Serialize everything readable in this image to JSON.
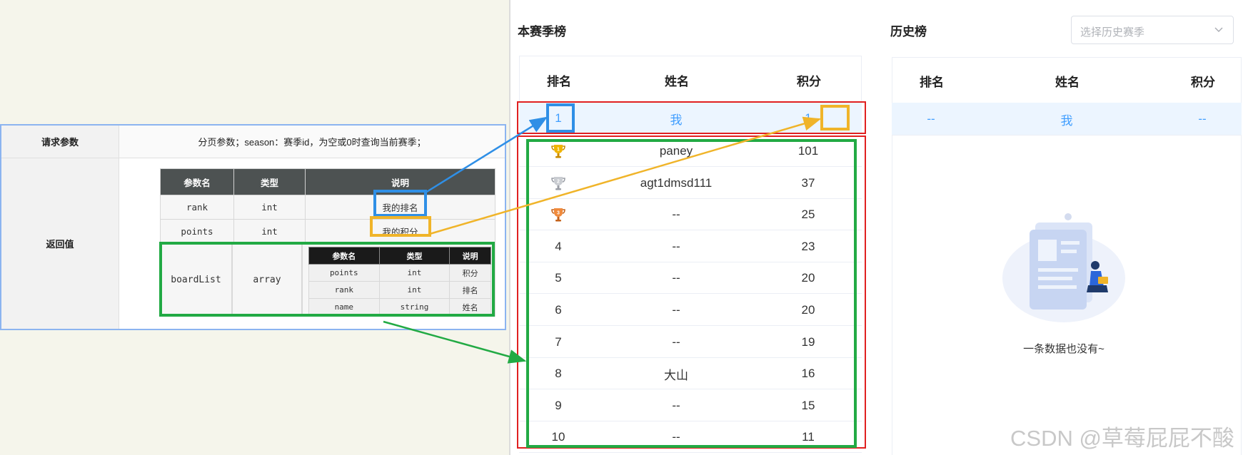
{
  "doc": {
    "request_label": "请求参数",
    "request_value": "分页参数；season：赛季id，为空或0时查询当前赛季；",
    "return_label": "返回值",
    "headers": [
      "参数名",
      "类型",
      "说明"
    ],
    "rows": [
      {
        "name": "rank",
        "type": "int",
        "desc": "我的排名"
      },
      {
        "name": "points",
        "type": "int",
        "desc": "我的积分"
      }
    ],
    "board": {
      "name": "boardList",
      "type": "array"
    },
    "sub_headers": [
      "参数名",
      "类型",
      "说明"
    ],
    "sub_rows": [
      {
        "name": "points",
        "type": "int",
        "desc": "积分"
      },
      {
        "name": "rank",
        "type": "int",
        "desc": "排名"
      },
      {
        "name": "name",
        "type": "string",
        "desc": "姓名"
      }
    ]
  },
  "current": {
    "title": "本赛季榜",
    "headers": [
      "排名",
      "姓名",
      "积分"
    ],
    "me": {
      "rank": "1",
      "name": "我",
      "points": "1"
    },
    "rows": [
      {
        "rank": "1",
        "name": "paney",
        "points": "101",
        "trophy": "gold-trophy-icon"
      },
      {
        "rank": "2",
        "name": "agt1dmsd111",
        "points": "37",
        "trophy": "silver-trophy-icon"
      },
      {
        "rank": "3",
        "name": "--",
        "points": "25",
        "trophy": "bronze-trophy-icon"
      },
      {
        "rank": "4",
        "name": "--",
        "points": "23"
      },
      {
        "rank": "5",
        "name": "--",
        "points": "20"
      },
      {
        "rank": "6",
        "name": "--",
        "points": "20"
      },
      {
        "rank": "7",
        "name": "--",
        "points": "19"
      },
      {
        "rank": "8",
        "name": "大山",
        "points": "16"
      },
      {
        "rank": "9",
        "name": "--",
        "points": "15"
      },
      {
        "rank": "10",
        "name": "--",
        "points": "11"
      }
    ]
  },
  "history": {
    "title": "历史榜",
    "select_placeholder": "选择历史赛季",
    "headers": [
      "排名",
      "姓名",
      "积分"
    ],
    "me": {
      "rank": "--",
      "name": "我",
      "points": "--"
    },
    "empty_text": "一条数据也没有~"
  },
  "watermark": "CSDN @草莓屁屁不酸",
  "colors": {
    "annot_blue": "#2f8fe6",
    "annot_yellow": "#f0b429",
    "annot_green": "#22aa44",
    "annot_red": "#e02020",
    "highlight_row": "#ecf5ff",
    "me_text": "#409eff"
  }
}
